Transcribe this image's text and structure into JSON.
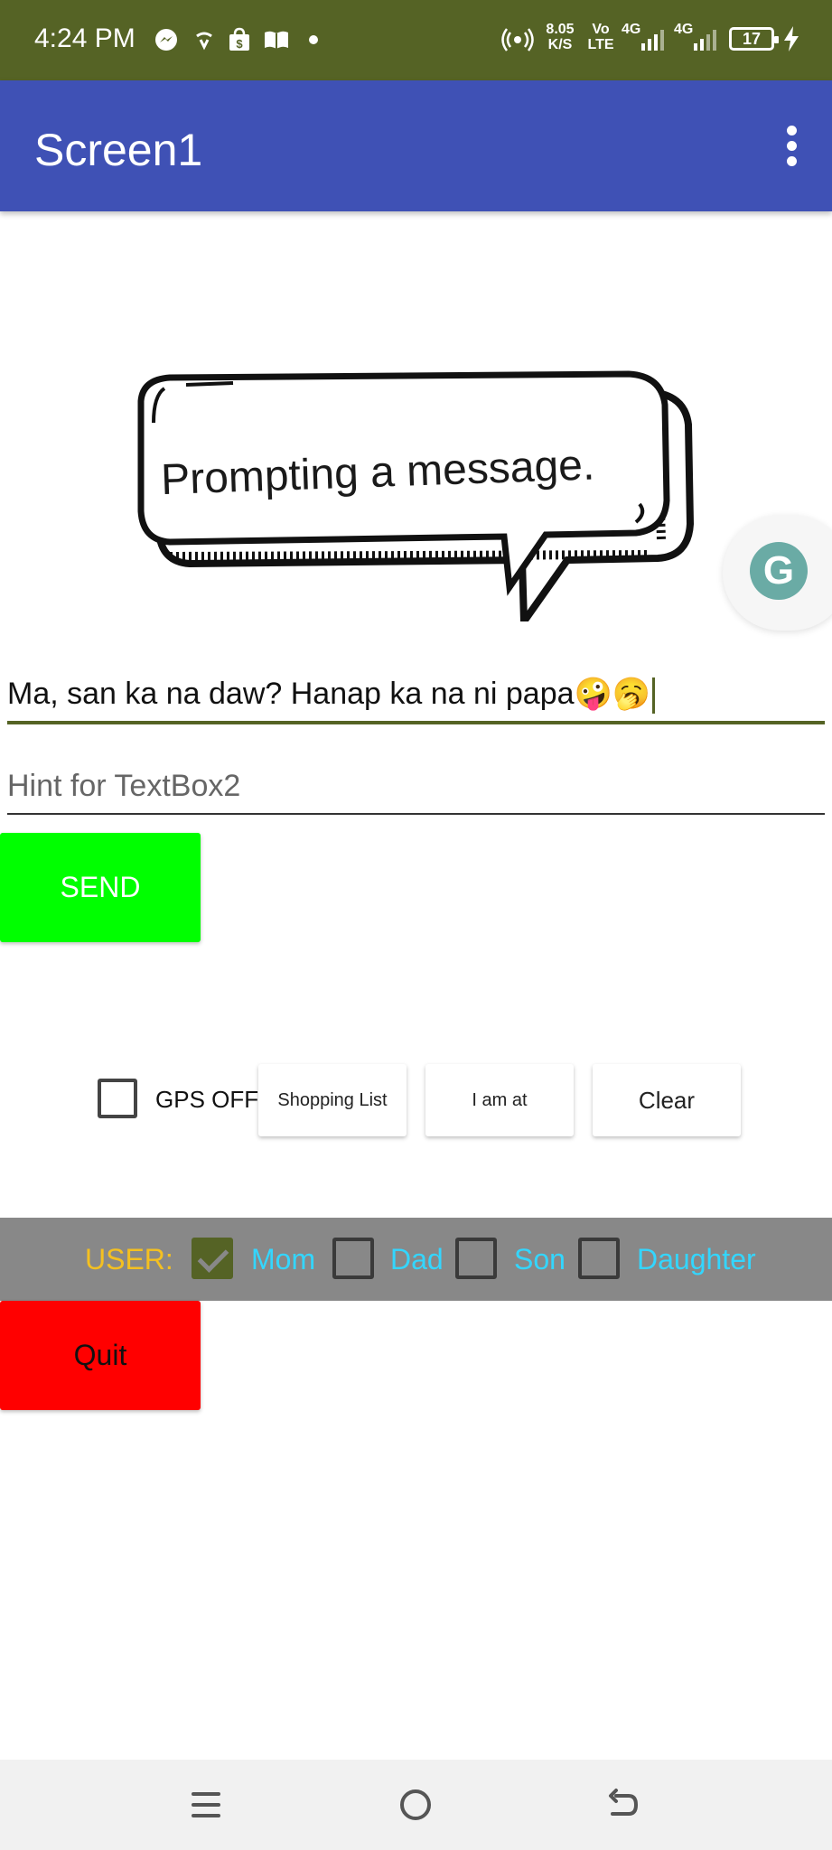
{
  "status_bar": {
    "time": "4:24 PM",
    "net_speed_value": "8.05",
    "net_speed_unit": "K/S",
    "volte_top": "Vo",
    "volte_bottom": "LTE",
    "sig1": "4G",
    "sig2": "4G",
    "battery": "17",
    "icons": [
      "messenger-icon",
      "wifi-share-icon",
      "shop-icon",
      "book-icon",
      "dot-icon",
      "hotspot-icon",
      "signal-icon",
      "charging-icon"
    ]
  },
  "app_bar": {
    "title": "Screen1",
    "menu_icon": "more-vert-icon",
    "color": "#3F51B5"
  },
  "bubble": {
    "text": "Prompting a message."
  },
  "textbox1": {
    "value": "Ma, san ka na daw? Hanap ka na ni papa🤪🥱"
  },
  "textbox2": {
    "placeholder": "Hint for TextBox2",
    "value": ""
  },
  "send_button": {
    "label": "SEND",
    "color": "#00ff00"
  },
  "actions": {
    "gps_label": "GPS OFF",
    "gps_checked": false,
    "shopping_list": "Shopping List",
    "i_am_at": "I am at",
    "clear": "Clear"
  },
  "user_bar": {
    "label": "USER:",
    "options": [
      {
        "label": "Mom",
        "checked": true
      },
      {
        "label": "Dad",
        "checked": false
      },
      {
        "label": "Son",
        "checked": false
      },
      {
        "label": "Daughter",
        "checked": false
      }
    ]
  },
  "quit_button": {
    "label": "Quit",
    "color": "#ff0000"
  },
  "nav_bar": {
    "icons": [
      "menu-icon",
      "home-icon",
      "back-icon"
    ]
  }
}
